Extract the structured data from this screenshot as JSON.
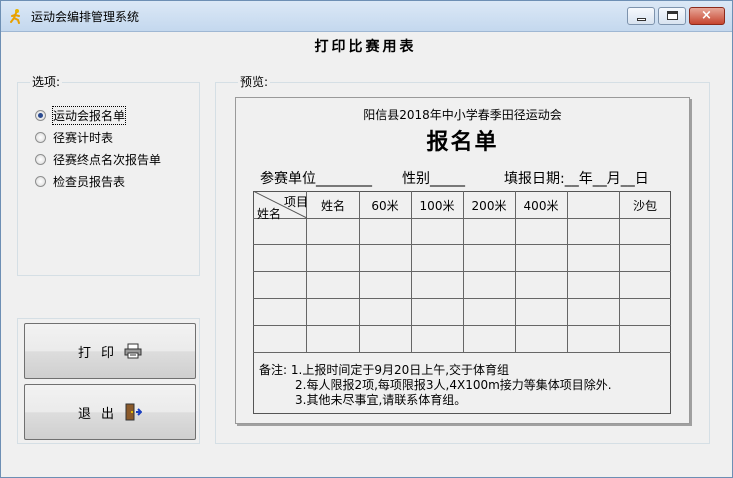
{
  "window": {
    "title": "运动会编排管理系统",
    "icons": {
      "app": "running-man-icon",
      "minimize": "minimize-icon",
      "maximize": "maximize-icon",
      "close": "close-icon"
    },
    "close_glyph": "×"
  },
  "heading": "打印比赛用表",
  "options": {
    "label": "选项:",
    "items": [
      {
        "label": "运动会报名单",
        "checked": true
      },
      {
        "label": "径赛计时表",
        "checked": false
      },
      {
        "label": "径赛终点名次报告单",
        "checked": false
      },
      {
        "label": "检查员报告表",
        "checked": false
      }
    ]
  },
  "buttons": {
    "print": {
      "label": "打印",
      "icon": "printer-icon"
    },
    "exit": {
      "label": "退出",
      "icon": "exit-door-icon"
    }
  },
  "preview": {
    "label": "预览:",
    "sheet": {
      "org": "阳信县2018年中小学春季田径运动会",
      "title": "报名单",
      "fields": {
        "unit": "参赛单位________",
        "gender": "性别_____",
        "date": "填报日期:__年__月__日"
      },
      "diag_top": "项目",
      "diag_bottom": "姓名",
      "columns": [
        "姓名",
        "60米",
        "100米",
        "200米",
        "400米",
        "",
        "沙包"
      ],
      "notes": {
        "prefix": "备注:",
        "lines": [
          "1.上报时间定于9月20日上午,交于体育组",
          "2.每人限报2项,每项限报3人,4X100m接力等集体项目除外.",
          "3.其他未尽事宜,请联系体育组。"
        ]
      }
    }
  },
  "colors": {
    "accent": "#2a4a8f",
    "close": "#c6452f"
  }
}
